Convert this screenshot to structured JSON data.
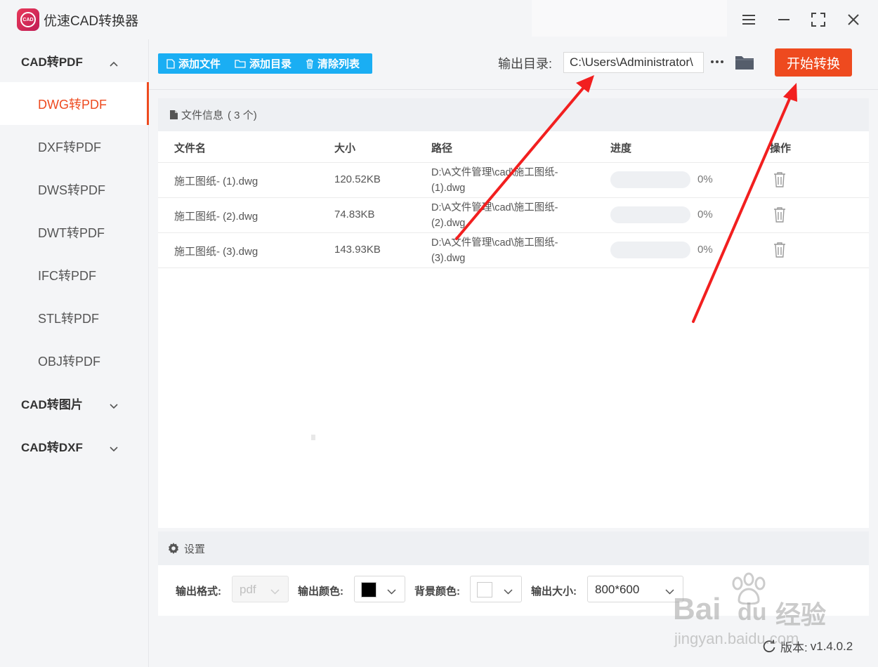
{
  "app": {
    "title": "优速CAD转换器",
    "logo_text": "CAD"
  },
  "colors": {
    "accent": "#ee4a1f",
    "toolbar_blue": "#1aaef3",
    "annotation_red": "#f21f1f"
  },
  "sidebar": {
    "groups": [
      {
        "label": "CAD转PDF",
        "expanded": true,
        "icon": "chevron-up-icon",
        "items": [
          {
            "label": "DWG转PDF",
            "active": true
          },
          {
            "label": "DXF转PDF",
            "active": false
          },
          {
            "label": "DWS转PDF",
            "active": false
          },
          {
            "label": "DWT转PDF",
            "active": false
          },
          {
            "label": "IFC转PDF",
            "active": false
          },
          {
            "label": "STL转PDF",
            "active": false
          },
          {
            "label": "OBJ转PDF",
            "active": false
          }
        ]
      },
      {
        "label": "CAD转图片",
        "expanded": false,
        "icon": "chevron-down-icon"
      },
      {
        "label": "CAD转DXF",
        "expanded": false,
        "icon": "chevron-down-icon"
      }
    ]
  },
  "toolbar": {
    "add_file": "添加文件",
    "add_dir": "添加目录",
    "clear_list": "清除列表",
    "output_label": "输出目录:",
    "output_path": "C:\\Users\\Administrator\\",
    "more": "···",
    "start": "开始转换"
  },
  "files": {
    "header_label": "文件信息",
    "count_label": "( 3 个)",
    "columns": {
      "name": "文件名",
      "size": "大小",
      "path": "路径",
      "progress": "进度",
      "action": "操作"
    },
    "rows": [
      {
        "name": "施工图纸- (1).dwg",
        "size": "120.52KB",
        "path_line1": "D:\\A文件管理\\cad\\施工图纸-",
        "path_line2": "(1).dwg",
        "progress": 0,
        "progress_label": "0%"
      },
      {
        "name": "施工图纸- (2).dwg",
        "size": "74.83KB",
        "path_line1": "D:\\A文件管理\\cad\\施工图纸-",
        "path_line2": "(2).dwg",
        "progress": 0,
        "progress_label": "0%"
      },
      {
        "name": "施工图纸- (3).dwg",
        "size": "143.93KB",
        "path_line1": "D:\\A文件管理\\cad\\施工图纸-",
        "path_line2": "(3).dwg",
        "progress": 0,
        "progress_label": "0%"
      }
    ]
  },
  "settings": {
    "title": "设置",
    "format_label": "输出格式:",
    "format_value": "pdf",
    "color_label": "输出颜色:",
    "color_value": "#000000",
    "bg_label": "背景颜色:",
    "bg_value": "#ffffff",
    "size_label": "输出大小:",
    "size_value": "800*600"
  },
  "footer": {
    "version_label": "版本:",
    "version": "v1.4.0.2"
  },
  "watermark": {
    "brand": "Bai",
    "paw": "du",
    "product": "经验",
    "url": "jingyan.baidu.com"
  }
}
